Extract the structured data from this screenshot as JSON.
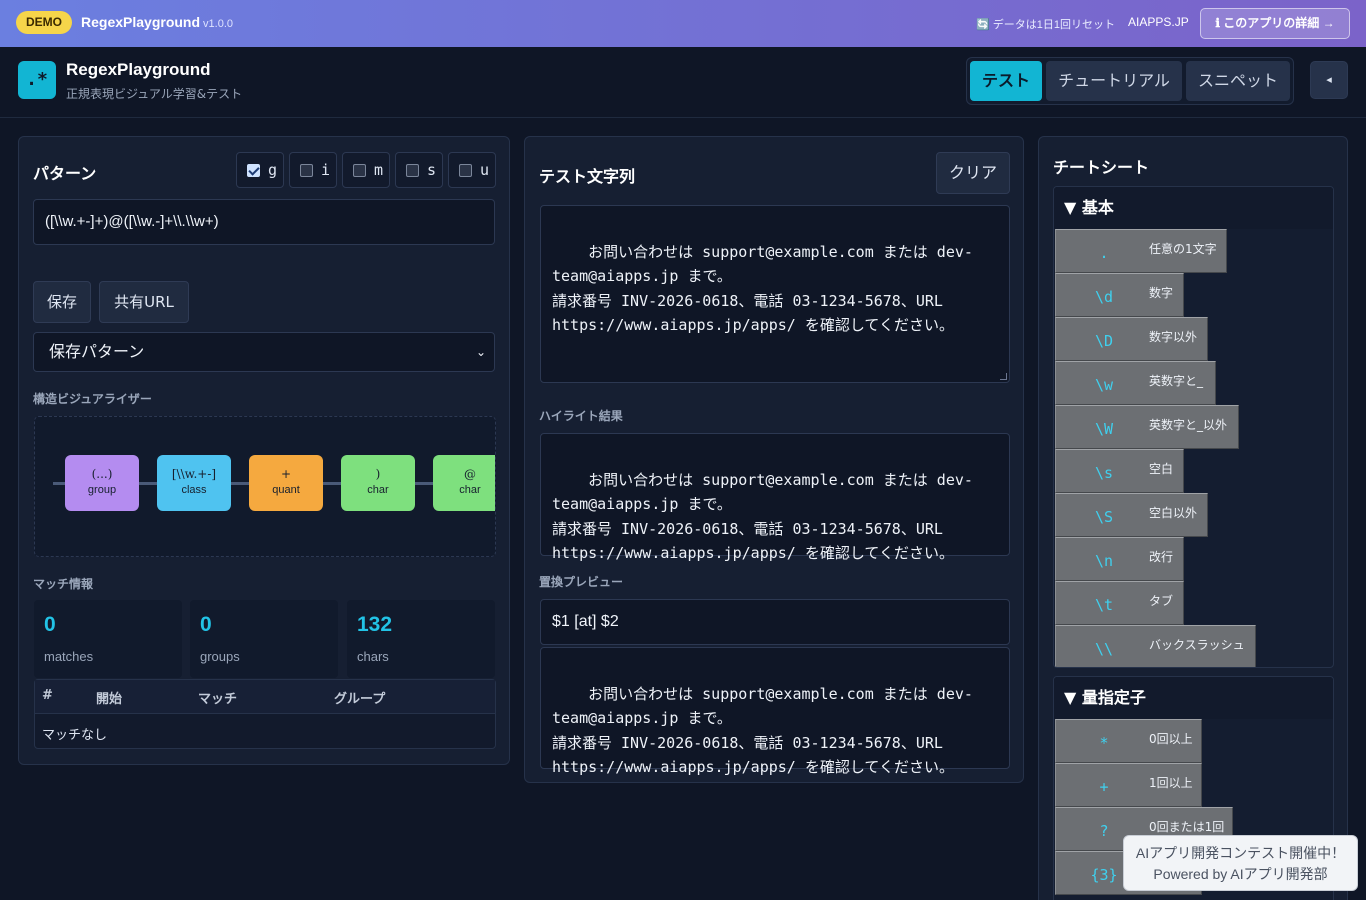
{
  "demo_bar": {
    "badge": "DEMO",
    "title": "RegexPlayground",
    "version": "v1.0.0",
    "reset_note": "🔄 データは1日1回リセット",
    "site": "AIAPPS.JP",
    "detail_button": "ℹ このアプリの詳細 →"
  },
  "header": {
    "logo": ".*",
    "app_name": "RegexPlayground",
    "subtitle": "正規表現ビジュアル学習&テスト",
    "tabs": [
      {
        "label": "テスト",
        "active": true
      },
      {
        "label": "チュートリアル",
        "active": false
      },
      {
        "label": "スニペット",
        "active": false
      }
    ],
    "collapse_icon": "◂"
  },
  "pattern_panel": {
    "title": "パターン",
    "flags": [
      {
        "name": "g",
        "checked": true
      },
      {
        "name": "i",
        "checked": false
      },
      {
        "name": "m",
        "checked": false
      },
      {
        "name": "s",
        "checked": false
      },
      {
        "name": "u",
        "checked": false
      }
    ],
    "pattern": "([\\\\w.+-]+)@([\\\\w.-]+\\\\.\\\\w+)",
    "save_button": "保存",
    "share_button": "共有URL",
    "saved_select": "保存パターン",
    "visualizer_label": "構造ビジュアライザー",
    "nodes": [
      {
        "sym": "(...)",
        "label": "group",
        "color": "#b48cf0"
      },
      {
        "sym": "[\\\\w.+-]",
        "label": "class",
        "color": "#4fc3f0"
      },
      {
        "sym": "+",
        "label": "quant",
        "color": "#f5a93f"
      },
      {
        "sym": ")",
        "label": "char",
        "color": "#7ee07e"
      },
      {
        "sym": "@",
        "label": "char",
        "color": "#7ee07e"
      }
    ],
    "match_info_label": "マッチ情報",
    "stats": [
      {
        "value": "0",
        "unit": "matches"
      },
      {
        "value": "0",
        "unit": "groups"
      },
      {
        "value": "132",
        "unit": "chars"
      }
    ],
    "table_headers": [
      "#",
      "開始",
      "マッチ",
      "グループ"
    ],
    "table_empty": "マッチなし"
  },
  "test_panel": {
    "title": "テスト文字列",
    "clear_button": "クリア",
    "test_string": "お問い合わせは support@example.com または dev-\nteam@aiapps.jp まで。\n請求番号 INV-2026-0618、電話 03-1234-5678、URL\nhttps://www.aiapps.jp/apps/ を確認してください。",
    "highlight_label": "ハイライト結果",
    "highlight_text": "お問い合わせは support@example.com または dev-\nteam@aiapps.jp まで。\n請求番号 INV-2026-0618、電話 03-1234-5678、URL\nhttps://www.aiapps.jp/apps/ を確認してください。",
    "replace_label": "置換プレビュー",
    "replace_input": "$1 [at] $2",
    "replace_text": "お問い合わせは support@example.com または dev-\nteam@aiapps.jp まで。\n請求番号 INV-2026-0618、電話 03-1234-5678、URL\nhttps://www.aiapps.jp/apps/ を確認してください。"
  },
  "cheatsheet": {
    "title": "チートシート",
    "groups": [
      {
        "title": "▼ 基本",
        "items": [
          {
            "token": ".",
            "desc": "任意の1文字"
          },
          {
            "token": "\\d",
            "desc": "数字"
          },
          {
            "token": "\\D",
            "desc": "数字以外"
          },
          {
            "token": "\\w",
            "desc": "英数字と_"
          },
          {
            "token": "\\W",
            "desc": "英数字と_以外"
          },
          {
            "token": "\\s",
            "desc": "空白"
          },
          {
            "token": "\\S",
            "desc": "空白以外"
          },
          {
            "token": "\\n",
            "desc": "改行"
          },
          {
            "token": "\\t",
            "desc": "タブ"
          },
          {
            "token": "\\\\",
            "desc": "バックスラッシュ"
          }
        ]
      },
      {
        "title": "▼ 量指定子",
        "items": [
          {
            "token": "*",
            "desc": "0回以上"
          },
          {
            "token": "+",
            "desc": "1回以上"
          },
          {
            "token": "?",
            "desc": "0回または1回"
          },
          {
            "token": "{3}",
            "desc": ""
          }
        ]
      }
    ]
  },
  "toast": {
    "line1": "AIアプリ開発コンテスト開催中！",
    "line2": "Powered by AIアプリ開発部"
  }
}
